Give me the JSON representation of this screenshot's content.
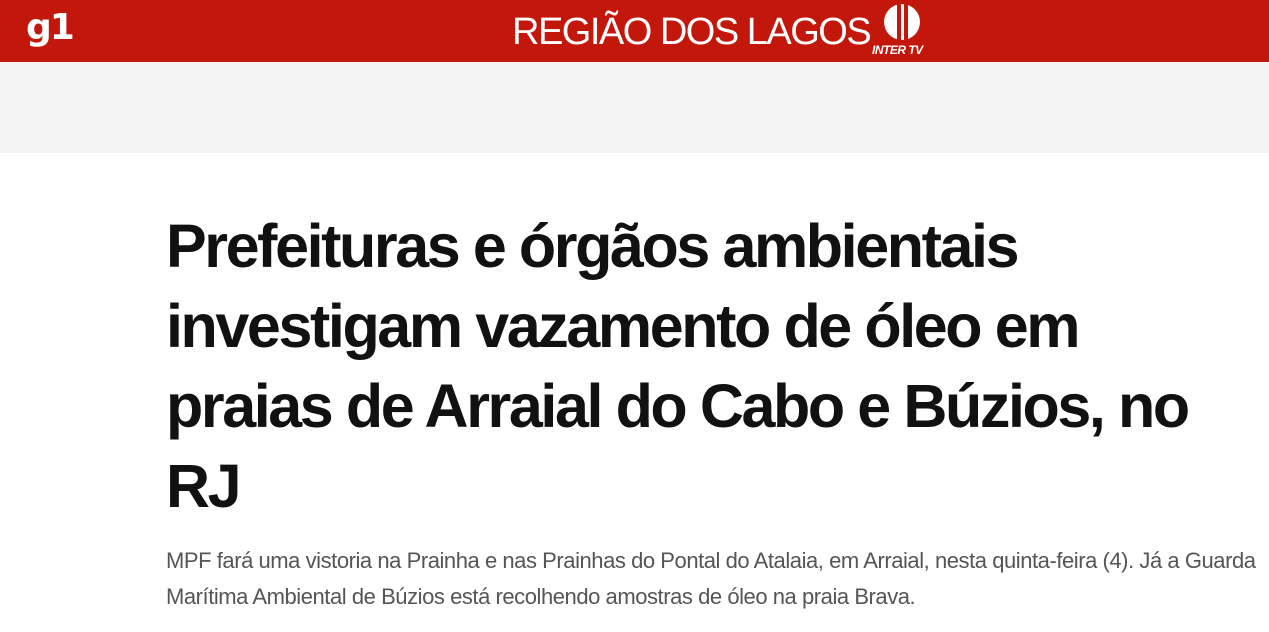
{
  "header": {
    "logo_text": "g1",
    "section_title": "REGIÃO DOS LAGOS",
    "affiliate_logo_text": "INTER TV",
    "background_color": "#c4170c"
  },
  "ad_band": {
    "background_color": "#f4f4f4"
  },
  "article": {
    "headline": "Prefeituras e órgãos ambientais investigam vazamento de óleo em praias de Arraial do Cabo e Búzios, no RJ",
    "subtitle": "MPF fará uma vistoria na Prainha e nas Prainhas do Pontal do Atalaia, em Arraial, nesta quinta-feira (4). Já a Guarda Marítima Ambiental de Búzios está recolhendo amostras de óleo na praia Brava."
  }
}
